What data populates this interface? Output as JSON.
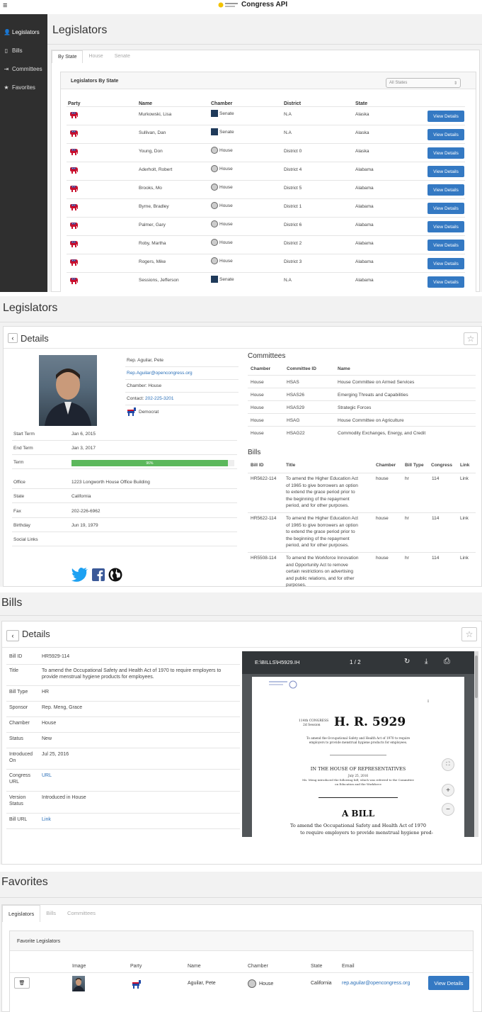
{
  "app": {
    "title": "Congress API"
  },
  "sidebar": {
    "items": [
      {
        "label": "Legislators",
        "icon": "user-icon",
        "active": true
      },
      {
        "label": "Bills",
        "icon": "file-icon"
      },
      {
        "label": "Committees",
        "icon": "sign-in-icon"
      },
      {
        "label": "Favorites",
        "icon": "star-icon"
      }
    ]
  },
  "legislators_page": {
    "title": "Legislators",
    "tabs": [
      "By State",
      "House",
      "Senate"
    ],
    "panel_title": "Legislators By State",
    "state_select": {
      "value": "All States",
      "arrow": "⇕"
    },
    "columns": [
      "Party",
      "Name",
      "Chamber",
      "District",
      "State"
    ],
    "view_details_label": "View Details",
    "rows": [
      {
        "party": "R",
        "name": "Murkowski, Lisa",
        "chamber": "Senate",
        "district": "N.A",
        "state": "Alaska"
      },
      {
        "party": "R",
        "name": "Sullivan, Dan",
        "chamber": "Senate",
        "district": "N.A",
        "state": "Alaska"
      },
      {
        "party": "R",
        "name": "Young, Don",
        "chamber": "House",
        "district": "District 0",
        "state": "Alaska"
      },
      {
        "party": "R",
        "name": "Aderholt, Robert",
        "chamber": "House",
        "district": "District 4",
        "state": "Alabama"
      },
      {
        "party": "R",
        "name": "Brooks, Mo",
        "chamber": "House",
        "district": "District 5",
        "state": "Alabama"
      },
      {
        "party": "R",
        "name": "Byrne, Bradley",
        "chamber": "House",
        "district": "District 1",
        "state": "Alabama"
      },
      {
        "party": "R",
        "name": "Palmer, Gary",
        "chamber": "House",
        "district": "District 6",
        "state": "Alabama"
      },
      {
        "party": "R",
        "name": "Roby, Martha",
        "chamber": "House",
        "district": "District 2",
        "state": "Alabama"
      },
      {
        "party": "R",
        "name": "Rogers, Mike",
        "chamber": "House",
        "district": "District 3",
        "state": "Alabama"
      },
      {
        "party": "R",
        "name": "Sessions, Jefferson",
        "chamber": "Senate",
        "district": "N.A",
        "state": "Alabama"
      }
    ]
  },
  "legislator_detail": {
    "page_title": "Legislators",
    "back": "‹",
    "title": "Details",
    "star": "☆",
    "name": "Rep. Aguilar, Pete",
    "email": "Rep.Aguilar@opencongress.org",
    "chamber_line": "Chamber: House",
    "contact_label": "Contact:",
    "contact": "202-225-3201",
    "party": "Democrat",
    "fields": [
      {
        "label": "Start Term",
        "value": "Jan 6, 2015"
      },
      {
        "label": "End Term",
        "value": "Jan 3, 2017"
      },
      {
        "label": "Term",
        "value": ""
      },
      {
        "label": "Office",
        "value": "1223 Longworth House Office Building"
      },
      {
        "label": "State",
        "value": "California"
      },
      {
        "label": "Fax",
        "value": "202-226-6962"
      },
      {
        "label": "Birthday",
        "value": "Jun 19, 1979"
      },
      {
        "label": "Social Links",
        "value": ""
      }
    ],
    "term_progress": {
      "percent": 96,
      "label": "96%"
    },
    "committees_title": "Committees",
    "committee_columns": [
      "Chamber",
      "Committee ID",
      "Name"
    ],
    "committees": [
      {
        "chamber": "House",
        "id": "HSAS",
        "name": "House Committee on Armed Services"
      },
      {
        "chamber": "House",
        "id": "HSAS26",
        "name": "Emerging Threats and Capabilities"
      },
      {
        "chamber": "House",
        "id": "HSAS29",
        "name": "Strategic Forces"
      },
      {
        "chamber": "House",
        "id": "HSAG",
        "name": "House Committee on Agriculture"
      },
      {
        "chamber": "House",
        "id": "HSAG22",
        "name": "Commodity Exchanges, Energy, and Credit"
      }
    ],
    "bills_title": "Bills",
    "bill_columns": [
      "Bill ID",
      "Title",
      "Chamber",
      "Bill Type",
      "Congress",
      "Link"
    ],
    "bills": [
      {
        "id": "HR5622-114",
        "title": [
          "To amend the Higher Education Act",
          "of 1965 to give borrowers an option",
          "to extend the grace period prior to",
          "the beginning of the repayment",
          "period, and for other purposes."
        ],
        "chamber": "house",
        "type": "hr",
        "congress": "114",
        "link": "Link"
      },
      {
        "id": "HR5622-114",
        "title": [
          "To amend the Higher Education Act",
          "of 1965 to give borrowers an option",
          "to extend the grace period prior to",
          "the beginning of the repayment",
          "period, and for other purposes."
        ],
        "chamber": "house",
        "type": "hr",
        "congress": "114",
        "link": "Link"
      },
      {
        "id": "HR5508-114",
        "title": [
          "To amend the Workforce Innovation",
          "and Opportunity Act to remove",
          "certain restrictions on advertising",
          "and public relations, and for other",
          "purposes."
        ],
        "chamber": "house",
        "type": "hr",
        "congress": "114",
        "link": "Link"
      }
    ]
  },
  "bill_detail": {
    "page_title": "Bills",
    "back": "‹",
    "title": "Details",
    "star": "☆",
    "fields": [
      {
        "label": "Bill ID",
        "value": "HR5929-114"
      },
      {
        "label": "Title",
        "value": "To amend the Occupational Safety and Health Act of 1970 to require employers to",
        "value2": "provide menstrual hygiene products for employees."
      },
      {
        "label": "Bill Type",
        "value": "HR"
      },
      {
        "label": "Sponsor",
        "value": "Rep. Meng, Grace"
      },
      {
        "label": "Chamber",
        "value": "House"
      },
      {
        "label": "Status",
        "value": "New"
      },
      {
        "label": "Introduced",
        "label2": "On",
        "value": "Jul 25, 2016"
      },
      {
        "label": "Congress",
        "label2": "URL",
        "value": "URL"
      },
      {
        "label": "Version",
        "label2": "Status",
        "value": "Introduced in House"
      },
      {
        "label": "Bill URL",
        "value": "Link"
      }
    ],
    "pdf": {
      "filename": "E:\\BILLS\\H5929.IH",
      "page": "1 / 2",
      "refresh": "↻",
      "download": "⤓",
      "print": "⎙",
      "fit": "⛶",
      "zoom_in": "+",
      "zoom_out": "−",
      "page_mark": "I",
      "congress": "114th CONGRESS",
      "session": "2d Session",
      "bill_number": "H. R. 5929",
      "short_desc_1": "To amend the Occupational Safety and Health Act of 1970 to require",
      "short_desc_2": "employers to provide menstrual hygiene products for employees.",
      "house": "IN THE HOUSE OF REPRESENTATIVES",
      "date": "July 25, 2016",
      "intro_1": "Ms. Meng introduced the following bill; which was referred to the Committee",
      "intro_2": "on Education and the Workforce",
      "a_bill": "A BILL",
      "long_1": "To amend the Occupational Safety and Health Act of 1970",
      "long_2": "to require employers to provide menstrual hygiene prod-"
    }
  },
  "favorites": {
    "page_title": "Favorites",
    "tabs": [
      "Legislators",
      "Bills",
      "Committees"
    ],
    "panel_title": "Favorite Legislators",
    "columns": [
      "Image",
      "Party",
      "Name",
      "Chamber",
      "State",
      "Email"
    ],
    "rows": [
      {
        "party": "D",
        "name": "Aguilar, Pete",
        "chamber": "House",
        "state": "California",
        "email": "rep.aguilar@opencongress.org"
      }
    ],
    "view_details_label": "View Details",
    "trash_icon": "🗑"
  },
  "colors": {
    "primary": "#3479c3",
    "sidebar": "#2f2f2f",
    "republican": "#c8102e",
    "democrat": "#1f4aa8",
    "progress": "#5cb85c"
  }
}
